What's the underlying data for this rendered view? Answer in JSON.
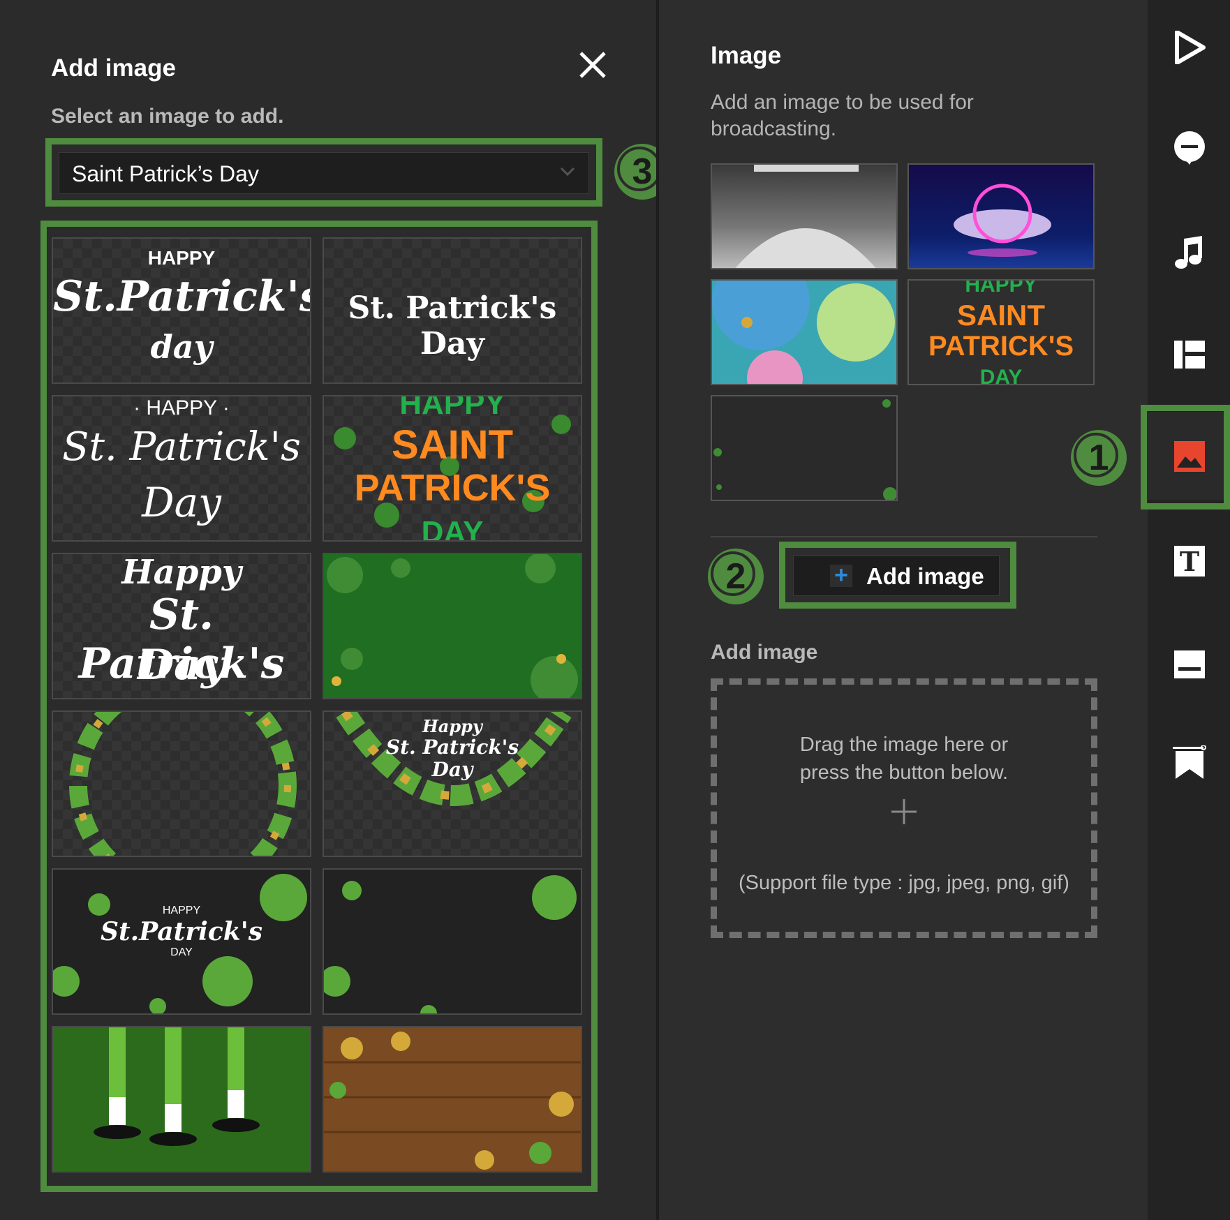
{
  "add_image_panel": {
    "title": "Add image",
    "subtitle": "Select an image to add.",
    "category_value": "Saint Patrick’s Day",
    "tiles": [
      {
        "line1": "HAPPY",
        "line2": "St.Patrick's",
        "line3": "day"
      },
      {
        "line1": "St. Patrick's Day"
      },
      {
        "line1": "· HAPPY ·",
        "line2": "St. Patrick's",
        "line3": "Day"
      },
      {
        "line1": "HAPPY",
        "line2": "SAINT",
        "line3": "PATRICK'S",
        "line4": "DAY"
      },
      {
        "line1": "Happy",
        "line2": "St. Patrick's",
        "line3": "Day"
      },
      {},
      {},
      {
        "line1": "Happy",
        "line2": "St. Patrick's",
        "line3": "Day"
      },
      {
        "line1": "HAPPY",
        "line2": "St.Patrick's",
        "line3": "DAY"
      },
      {},
      {},
      {}
    ]
  },
  "image_panel": {
    "title": "Image",
    "description_line1": "Add an image to be used for",
    "description_line2": "broadcasting.",
    "thumb_text": {
      "line1": "HAPPY",
      "line2": "SAINT",
      "line3": "PATRICK'S",
      "line4": "DAY"
    },
    "add_button_label": "Add image",
    "section_label": "Add image",
    "dropzone_line1": "Drag the image here or",
    "dropzone_line2": "press the button below.",
    "dropzone_support": "(Support file type : jpg, jpeg, png, gif)"
  },
  "badges": {
    "one": "1",
    "two": "2",
    "three": "3"
  },
  "colors": {
    "highlight_green": "#4f8c3f",
    "active_icon": "#e8452f",
    "plus_blue": "#2f8ad8"
  },
  "rail_icons": [
    "play-icon",
    "chat-icon",
    "music-icon",
    "layout-icon",
    "image-icon",
    "text-icon",
    "caption-icon",
    "bookmark-icon"
  ]
}
